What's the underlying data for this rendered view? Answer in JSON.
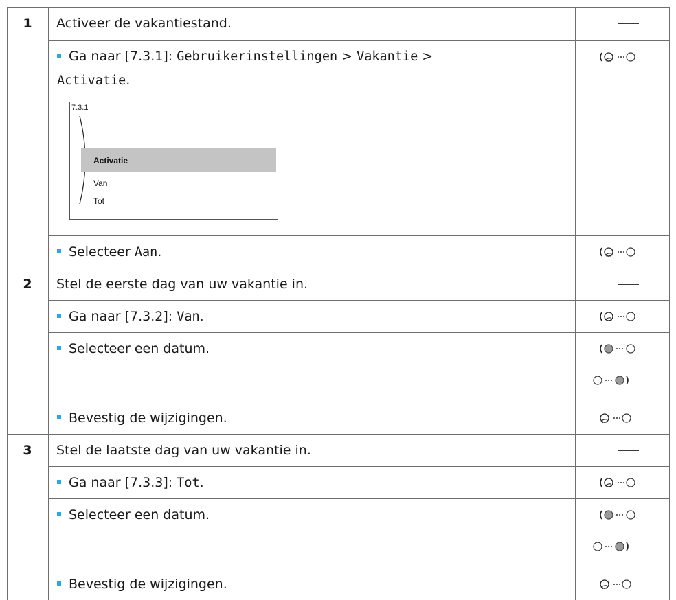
{
  "steps": [
    {
      "number": "1",
      "title": "Activeer de vakantiestand.",
      "title_action": "—",
      "substeps": [
        {
          "parts": [
            "Ga naar [7.3.1]: ",
            "Gebruikerinstellingen",
            " > ",
            "Vakantie",
            " > ",
            "Activatie",
            "."
          ],
          "action_icon": "dial-left-turn-icon",
          "screen": {
            "title": "7.3.1",
            "items": [
              "Activatie",
              "Van",
              "Tot"
            ],
            "selected": "Activatie"
          }
        },
        {
          "parts": [
            "Selecteer ",
            "Aan",
            "."
          ],
          "action_icon": "dial-left-turn-icon"
        }
      ]
    },
    {
      "number": "2",
      "title": "Stel de eerste dag van uw vakantie in.",
      "title_action": "—",
      "substeps": [
        {
          "parts": [
            "Ga naar [7.3.2]: ",
            "Van",
            "."
          ],
          "action_icon": "dial-left-turn-icon"
        },
        {
          "text": "Selecteer een datum.",
          "action_icons": [
            "dial-left-rotate-icon",
            "dial-right-rotate-icon"
          ]
        },
        {
          "text": "Bevestig de wijzigingen.",
          "action_icon": "dial-left-press-icon"
        }
      ]
    },
    {
      "number": "3",
      "title": "Stel de laatste dag van uw vakantie in.",
      "title_action": "—",
      "substeps": [
        {
          "parts": [
            "Ga naar [7.3.3]: ",
            "Tot",
            "."
          ],
          "action_icon": "dial-left-turn-icon"
        },
        {
          "text": "Selecteer een datum.",
          "action_icons": [
            "dial-left-rotate-icon",
            "dial-right-rotate-icon"
          ]
        },
        {
          "text": "Bevestig de wijzigingen.",
          "action_icon": "dial-left-press-icon"
        }
      ]
    }
  ],
  "colors": {
    "bullet": "#2aa8e0",
    "border": "#6e6e6e",
    "highlight": "#c4c4c4"
  }
}
